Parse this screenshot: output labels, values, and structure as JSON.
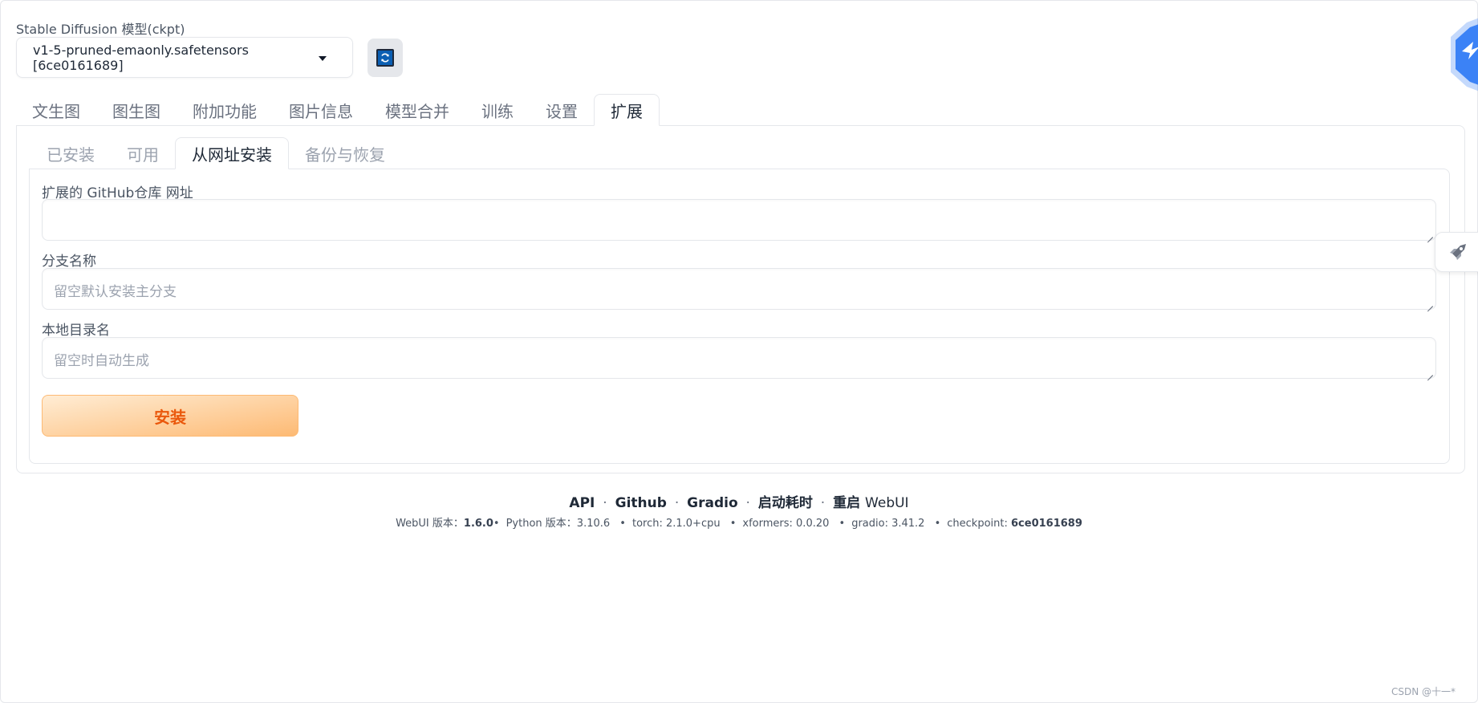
{
  "model": {
    "label": "Stable Diffusion 模型(ckpt)",
    "selected": "v1-5-pruned-emaonly.safetensors [6ce0161689]",
    "refresh_icon": "refresh-icon"
  },
  "top_tabs": [
    {
      "label": "文生图",
      "active": false
    },
    {
      "label": "图生图",
      "active": false
    },
    {
      "label": "附加功能",
      "active": false
    },
    {
      "label": "图片信息",
      "active": false
    },
    {
      "label": "模型合并",
      "active": false
    },
    {
      "label": "训练",
      "active": false
    },
    {
      "label": "设置",
      "active": false
    },
    {
      "label": "扩展",
      "active": true
    }
  ],
  "sub_tabs": [
    {
      "label": "已安装",
      "active": false
    },
    {
      "label": "可用",
      "active": false
    },
    {
      "label": "从网址安装",
      "active": true
    },
    {
      "label": "备份与恢复",
      "active": false
    }
  ],
  "form": {
    "repo_label": "扩展的 GitHub仓库 网址",
    "repo_value": "",
    "repo_placeholder": "",
    "branch_label": "分支名称",
    "branch_placeholder": "留空默认安装主分支",
    "dir_label": "本地目录名",
    "dir_placeholder": "留空时自动生成",
    "install_label": "安装"
  },
  "footer": {
    "links": [
      "API",
      "Github",
      "Gradio",
      "启动耗时",
      "重启"
    ],
    "restart_suffix": "WebUI",
    "sep": "·",
    "webui_label": "WebUI 版本：",
    "webui_version": "1.6.0",
    "python_label": "Python 版本：",
    "python_version": "3.10.6",
    "torch": "torch: 2.1.0+cpu",
    "xformers": "xformers: 0.0.20",
    "gradio": "gradio: 3.41.2",
    "checkpoint_label": "checkpoint:",
    "checkpoint_value": "6ce0161689"
  },
  "watermark": "CSDN @十一*",
  "colors": {
    "accent": "#ea580c",
    "button_from": "#ffedd5",
    "button_to": "#fdba74",
    "logo": "#3b82f6"
  }
}
